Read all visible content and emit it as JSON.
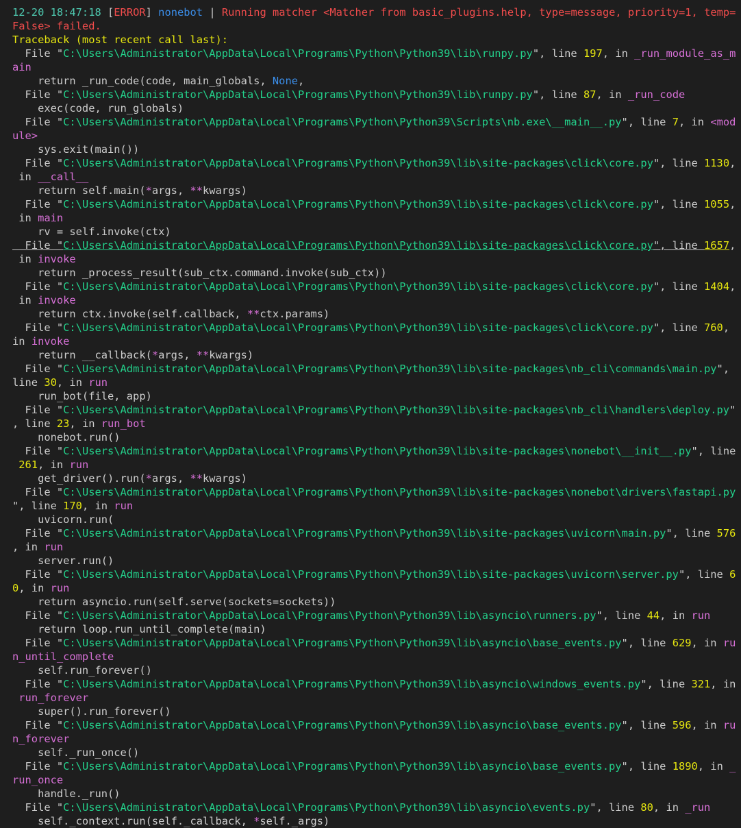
{
  "terminal": {
    "lines": [
      [
        [
          "c-time",
          "12-20 18:47:18 "
        ],
        [
          "c-code",
          "["
        ],
        [
          "c-err",
          "ERROR"
        ],
        [
          "c-code",
          "] "
        ],
        [
          "c-src",
          "nonebot"
        ],
        [
          "c-code",
          " | "
        ],
        [
          "c-msg",
          "Running matcher <Matcher from basic_plugins.help, type=message, priority=1, temp="
        ]
      ],
      [
        [
          "c-msg",
          "False> failed."
        ]
      ],
      [
        [
          "c-tb",
          "Traceback (most recent call last):"
        ]
      ],
      [
        [
          "c-code",
          "  File \""
        ],
        [
          "c-path",
          "C:\\Users\\Administrator\\AppData\\Local\\Programs\\Python\\Python39\\lib\\runpy.py"
        ],
        [
          "c-code",
          "\", line "
        ],
        [
          "c-num",
          "197"
        ],
        [
          "c-code",
          ", in "
        ],
        [
          "c-func",
          "_run_module_as_m"
        ]
      ],
      [
        [
          "c-func",
          "ain"
        ]
      ],
      [
        [
          "c-code",
          "    return _run_code(code, main_globals, "
        ],
        [
          "c-none",
          "None"
        ],
        [
          "c-code",
          ","
        ]
      ],
      [
        [
          "c-code",
          "  File \""
        ],
        [
          "c-path",
          "C:\\Users\\Administrator\\AppData\\Local\\Programs\\Python\\Python39\\lib\\runpy.py"
        ],
        [
          "c-code",
          "\", line "
        ],
        [
          "c-num",
          "87"
        ],
        [
          "c-code",
          ", in "
        ],
        [
          "c-func",
          "_run_code"
        ]
      ],
      [
        [
          "c-code",
          "    exec(code, run_globals)"
        ]
      ],
      [
        [
          "c-code",
          "  File \""
        ],
        [
          "c-path",
          "C:\\Users\\Administrator\\AppData\\Local\\Programs\\Python\\Python39\\Scripts\\nb.exe\\__main__.py"
        ],
        [
          "c-code",
          "\", line "
        ],
        [
          "c-num",
          "7"
        ],
        [
          "c-code",
          ", in "
        ],
        [
          "c-func",
          "<mod"
        ]
      ],
      [
        [
          "c-func",
          "ule>"
        ]
      ],
      [
        [
          "c-code",
          "    sys.exit(main())"
        ]
      ],
      [
        [
          "c-code",
          "  File \""
        ],
        [
          "c-path",
          "C:\\Users\\Administrator\\AppData\\Local\\Programs\\Python\\Python39\\lib\\site-packages\\click\\core.py"
        ],
        [
          "c-code",
          "\", line "
        ],
        [
          "c-num",
          "1130"
        ],
        [
          "c-code",
          ","
        ]
      ],
      [
        [
          "c-code",
          " in "
        ],
        [
          "c-func",
          "__call__"
        ]
      ],
      [
        [
          "c-code",
          "    return self.main("
        ],
        [
          "c-op",
          "*"
        ],
        [
          "c-code",
          "args, "
        ],
        [
          "c-op",
          "**"
        ],
        [
          "c-code",
          "kwargs)"
        ]
      ],
      [
        [
          "c-code",
          "  File \""
        ],
        [
          "c-path",
          "C:\\Users\\Administrator\\AppData\\Local\\Programs\\Python\\Python39\\lib\\site-packages\\click\\core.py"
        ],
        [
          "c-code",
          "\", line "
        ],
        [
          "c-num",
          "1055"
        ],
        [
          "c-code",
          ","
        ]
      ],
      [
        [
          "c-code",
          " in "
        ],
        [
          "c-func",
          "main"
        ]
      ],
      [
        [
          "c-code",
          "    rv = self.invoke(ctx)"
        ]
      ],
      [
        [
          "c-code u",
          "  File \""
        ],
        [
          "c-path u",
          "C:\\Users\\Administrator\\AppData\\Local\\Programs\\Python\\Python39\\lib\\site-packages\\click\\core.py"
        ],
        [
          "c-code u",
          "\", line "
        ],
        [
          "c-num u",
          "1657"
        ],
        [
          "c-code",
          ","
        ]
      ],
      [
        [
          "c-code",
          " in "
        ],
        [
          "c-func",
          "invoke"
        ]
      ],
      [
        [
          "c-code",
          "    return _process_result(sub_ctx.command.invoke(sub_ctx))"
        ]
      ],
      [
        [
          "c-code",
          "  File \""
        ],
        [
          "c-path",
          "C:\\Users\\Administrator\\AppData\\Local\\Programs\\Python\\Python39\\lib\\site-packages\\click\\core.py"
        ],
        [
          "c-code",
          "\", line "
        ],
        [
          "c-num",
          "1404"
        ],
        [
          "c-code",
          ","
        ]
      ],
      [
        [
          "c-code",
          " in "
        ],
        [
          "c-func",
          "invoke"
        ]
      ],
      [
        [
          "c-code",
          "    return ctx.invoke(self.callback, "
        ],
        [
          "c-op",
          "**"
        ],
        [
          "c-code",
          "ctx.params)"
        ]
      ],
      [
        [
          "c-code",
          "  File \""
        ],
        [
          "c-path",
          "C:\\Users\\Administrator\\AppData\\Local\\Programs\\Python\\Python39\\lib\\site-packages\\click\\core.py"
        ],
        [
          "c-code",
          "\", line "
        ],
        [
          "c-num",
          "760"
        ],
        [
          "c-code",
          ","
        ]
      ],
      [
        [
          "c-code",
          "in "
        ],
        [
          "c-func",
          "invoke"
        ]
      ],
      [
        [
          "c-code",
          "    return __callback("
        ],
        [
          "c-op",
          "*"
        ],
        [
          "c-code",
          "args, "
        ],
        [
          "c-op",
          "**"
        ],
        [
          "c-code",
          "kwargs)"
        ]
      ],
      [
        [
          "c-code",
          "  File \""
        ],
        [
          "c-path",
          "C:\\Users\\Administrator\\AppData\\Local\\Programs\\Python\\Python39\\lib\\site-packages\\nb_cli\\commands\\main.py"
        ],
        [
          "c-code",
          "\","
        ]
      ],
      [
        [
          "c-code",
          "line "
        ],
        [
          "c-num",
          "30"
        ],
        [
          "c-code",
          ", in "
        ],
        [
          "c-func",
          "run"
        ]
      ],
      [
        [
          "c-code",
          "    run_bot(file, app)"
        ]
      ],
      [
        [
          "c-code",
          "  File \""
        ],
        [
          "c-path",
          "C:\\Users\\Administrator\\AppData\\Local\\Programs\\Python\\Python39\\lib\\site-packages\\nb_cli\\handlers\\deploy.py"
        ],
        [
          "c-code",
          "\""
        ]
      ],
      [
        [
          "c-code",
          ", line "
        ],
        [
          "c-num",
          "23"
        ],
        [
          "c-code",
          ", in "
        ],
        [
          "c-func",
          "run_bot"
        ]
      ],
      [
        [
          "c-code",
          "    nonebot.run()"
        ]
      ],
      [
        [
          "c-code",
          "  File \""
        ],
        [
          "c-path",
          "C:\\Users\\Administrator\\AppData\\Local\\Programs\\Python\\Python39\\lib\\site-packages\\nonebot\\__init__.py"
        ],
        [
          "c-code",
          "\", line"
        ]
      ],
      [
        [
          "c-code",
          " "
        ],
        [
          "c-num",
          "261"
        ],
        [
          "c-code",
          ", in "
        ],
        [
          "c-func",
          "run"
        ]
      ],
      [
        [
          "c-code",
          "    get_driver().run("
        ],
        [
          "c-op",
          "*"
        ],
        [
          "c-code",
          "args, "
        ],
        [
          "c-op",
          "**"
        ],
        [
          "c-code",
          "kwargs)"
        ]
      ],
      [
        [
          "c-code",
          "  File \""
        ],
        [
          "c-path",
          "C:\\Users\\Administrator\\AppData\\Local\\Programs\\Python\\Python39\\lib\\site-packages\\nonebot\\drivers\\fastapi.py"
        ]
      ],
      [
        [
          "c-code",
          "\", line "
        ],
        [
          "c-num",
          "170"
        ],
        [
          "c-code",
          ", in "
        ],
        [
          "c-func",
          "run"
        ]
      ],
      [
        [
          "c-code",
          "    uvicorn.run("
        ]
      ],
      [
        [
          "c-code",
          "  File \""
        ],
        [
          "c-path",
          "C:\\Users\\Administrator\\AppData\\Local\\Programs\\Python\\Python39\\lib\\site-packages\\uvicorn\\main.py"
        ],
        [
          "c-code",
          "\", line "
        ],
        [
          "c-num",
          "576"
        ]
      ],
      [
        [
          "c-code",
          ", in "
        ],
        [
          "c-func",
          "run"
        ]
      ],
      [
        [
          "c-code",
          "    server.run()"
        ]
      ],
      [
        [
          "c-code",
          "  File \""
        ],
        [
          "c-path",
          "C:\\Users\\Administrator\\AppData\\Local\\Programs\\Python\\Python39\\lib\\site-packages\\uvicorn\\server.py"
        ],
        [
          "c-code",
          "\", line "
        ],
        [
          "c-num",
          "6"
        ]
      ],
      [
        [
          "c-num",
          "0"
        ],
        [
          "c-code",
          ", in "
        ],
        [
          "c-func",
          "run"
        ]
      ],
      [
        [
          "c-code",
          "    return asyncio.run(self.serve(sockets=sockets))"
        ]
      ],
      [
        [
          "c-code",
          "  File \""
        ],
        [
          "c-path",
          "C:\\Users\\Administrator\\AppData\\Local\\Programs\\Python\\Python39\\lib\\asyncio\\runners.py"
        ],
        [
          "c-code",
          "\", line "
        ],
        [
          "c-num",
          "44"
        ],
        [
          "c-code",
          ", in "
        ],
        [
          "c-func",
          "run"
        ]
      ],
      [
        [
          "c-code",
          "    return loop.run_until_complete(main)"
        ]
      ],
      [
        [
          "c-code",
          "  File \""
        ],
        [
          "c-path",
          "C:\\Users\\Administrator\\AppData\\Local\\Programs\\Python\\Python39\\lib\\asyncio\\base_events.py"
        ],
        [
          "c-code",
          "\", line "
        ],
        [
          "c-num",
          "629"
        ],
        [
          "c-code",
          ", in "
        ],
        [
          "c-func",
          "ru"
        ]
      ],
      [
        [
          "c-func",
          "n_until_complete"
        ]
      ],
      [
        [
          "c-code",
          "    self.run_forever()"
        ]
      ],
      [
        [
          "c-code",
          "  File \""
        ],
        [
          "c-path",
          "C:\\Users\\Administrator\\AppData\\Local\\Programs\\Python\\Python39\\lib\\asyncio\\windows_events.py"
        ],
        [
          "c-code",
          "\", line "
        ],
        [
          "c-num",
          "321"
        ],
        [
          "c-code",
          ", in"
        ]
      ],
      [
        [
          "c-code",
          " "
        ],
        [
          "c-func",
          "run_forever"
        ]
      ],
      [
        [
          "c-code",
          "    super().run_forever()"
        ]
      ],
      [
        [
          "c-code",
          "  File \""
        ],
        [
          "c-path",
          "C:\\Users\\Administrator\\AppData\\Local\\Programs\\Python\\Python39\\lib\\asyncio\\base_events.py"
        ],
        [
          "c-code",
          "\", line "
        ],
        [
          "c-num",
          "596"
        ],
        [
          "c-code",
          ", in "
        ],
        [
          "c-func",
          "ru"
        ]
      ],
      [
        [
          "c-func",
          "n_forever"
        ]
      ],
      [
        [
          "c-code",
          "    self._run_once()"
        ]
      ],
      [
        [
          "c-code",
          "  File \""
        ],
        [
          "c-path",
          "C:\\Users\\Administrator\\AppData\\Local\\Programs\\Python\\Python39\\lib\\asyncio\\base_events.py"
        ],
        [
          "c-code",
          "\", line "
        ],
        [
          "c-num",
          "1890"
        ],
        [
          "c-code",
          ", in "
        ],
        [
          "c-func",
          "_"
        ]
      ],
      [
        [
          "c-func",
          "run_once"
        ]
      ],
      [
        [
          "c-code",
          "    handle._run()"
        ]
      ],
      [
        [
          "c-code",
          "  File \""
        ],
        [
          "c-path",
          "C:\\Users\\Administrator\\AppData\\Local\\Programs\\Python\\Python39\\lib\\asyncio\\events.py"
        ],
        [
          "c-code",
          "\", line "
        ],
        [
          "c-num",
          "80"
        ],
        [
          "c-code",
          ", in "
        ],
        [
          "c-func",
          "_run"
        ]
      ],
      [
        [
          "c-code",
          "    self._context.run(self._callback, "
        ],
        [
          "c-op",
          "*"
        ],
        [
          "c-code",
          "self._args)"
        ]
      ]
    ]
  }
}
